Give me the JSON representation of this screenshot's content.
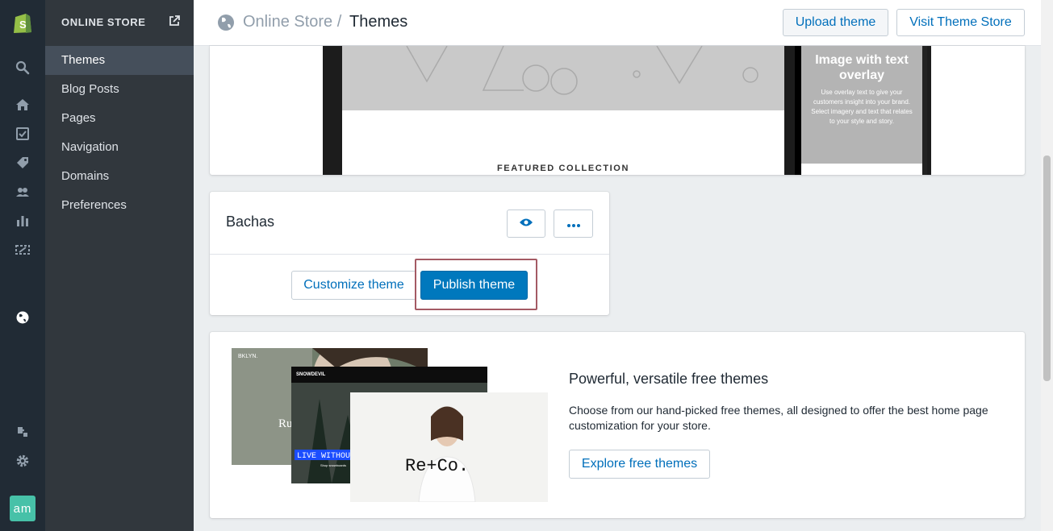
{
  "sidebar": {
    "section_title": "ONLINE STORE",
    "items": [
      {
        "label": "Themes",
        "active": true
      },
      {
        "label": "Blog Posts"
      },
      {
        "label": "Pages"
      },
      {
        "label": "Navigation"
      },
      {
        "label": "Domains"
      },
      {
        "label": "Preferences"
      }
    ]
  },
  "rail": {
    "icons": [
      "shopify-logo-icon",
      "search-icon",
      "home-icon",
      "orders-icon",
      "products-icon",
      "customers-icon",
      "reports-icon",
      "discounts-icon",
      "online-store-icon",
      "apps-icon",
      "settings-icon"
    ],
    "avatar_initials": "am"
  },
  "header": {
    "breadcrumb": "Online Store /",
    "title": "Themes",
    "upload_label": "Upload theme",
    "visit_store_label": "Visit Theme Store"
  },
  "preview": {
    "overlay_heading": "Image with text overlay",
    "overlay_body": "Use overlay text to give your customers insight into your brand. Select imagery and text that relates to your style and story.",
    "featured_label": "FEATURED COLLECTION"
  },
  "theme_card": {
    "name": "Bachas",
    "customize_label": "Customize theme",
    "publish_label": "Publish theme"
  },
  "free_themes": {
    "title": "Powerful, versatile free themes",
    "description": "Choose from our hand-picked free themes, all designed to offer the best home page customization for your store.",
    "explore_label": "Explore free themes",
    "shot1_brand": "BKLYN.",
    "shot1_text": "Ru",
    "shot2_brand": "SNOWDEVIL",
    "shot2_banner": "LIVE WITHOU",
    "shot2_sub": "Shop snowboards",
    "shot3_brand": "Re+Co."
  },
  "colors": {
    "rail": "#212b35",
    "subnav": "#31373d",
    "accent": "#006fbb",
    "primary": "#0078bd",
    "highlight": "#a45a64"
  }
}
